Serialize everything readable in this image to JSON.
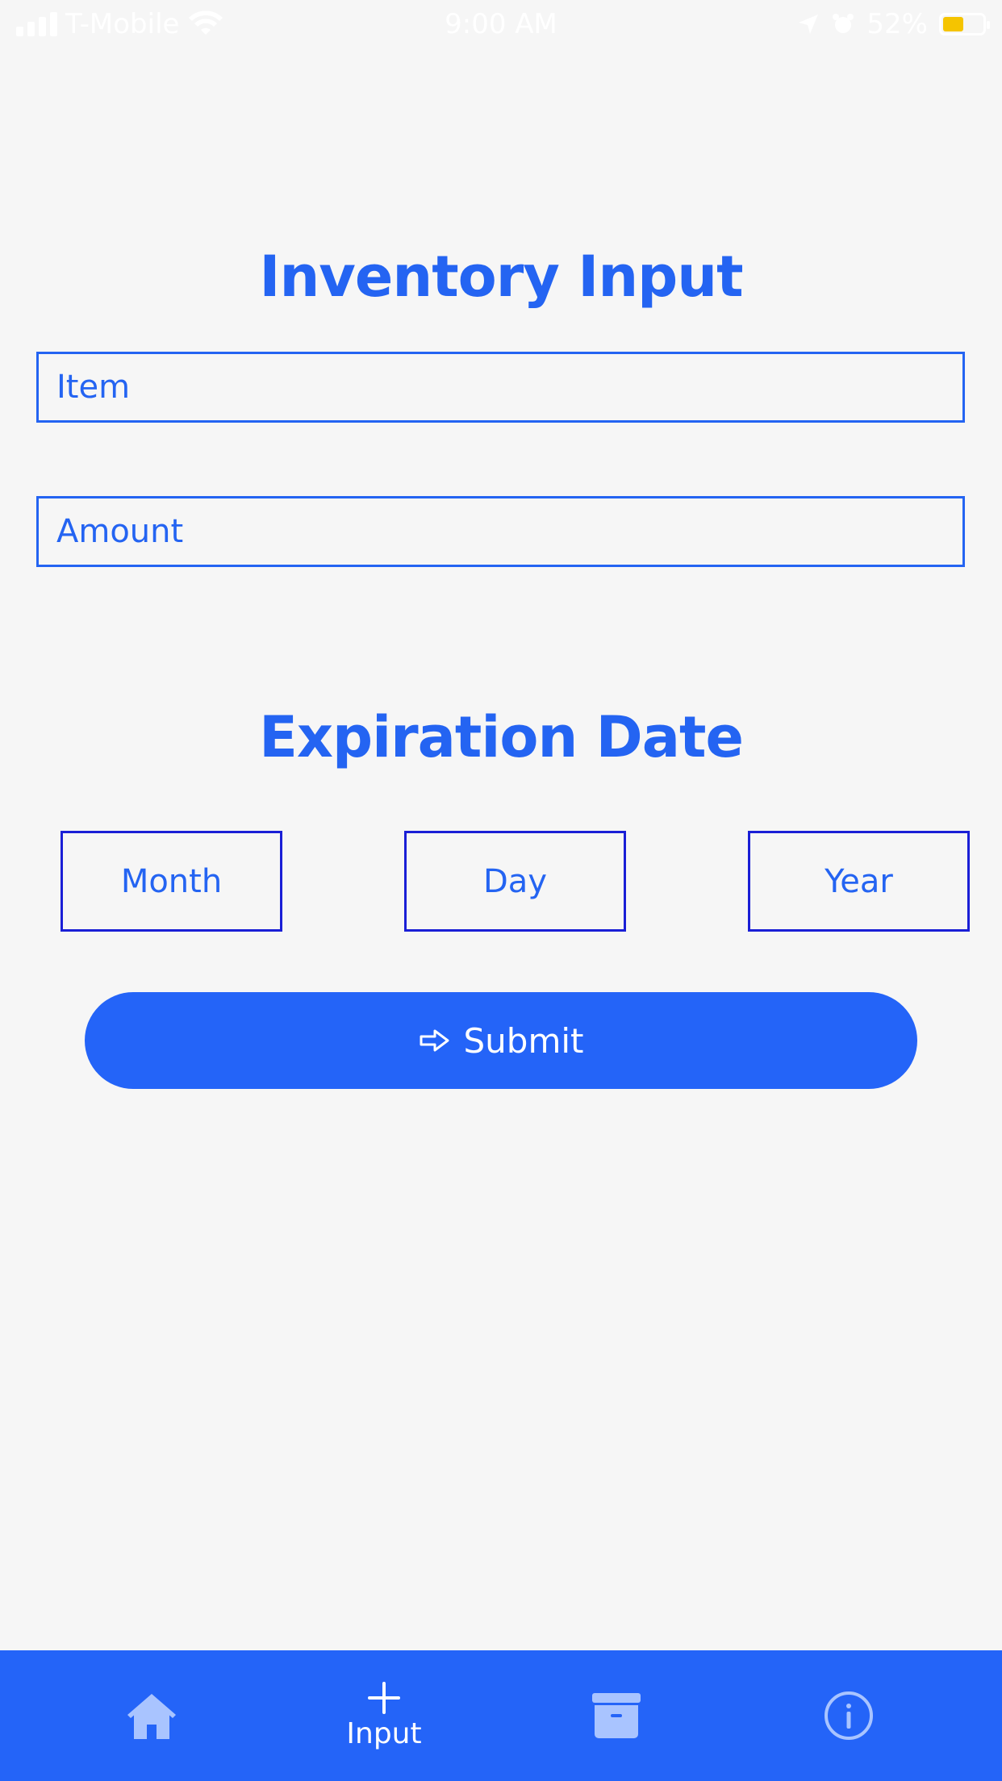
{
  "status_bar": {
    "carrier": "T-Mobile",
    "time": "9:00 AM",
    "battery": "52%",
    "battery_level": 0.52
  },
  "inventory": {
    "title": "Inventory Input",
    "item_placeholder": "Item",
    "amount_placeholder": "Amount"
  },
  "expiration": {
    "title": "Expiration Date",
    "month_label": "Month",
    "day_label": "Day",
    "year_label": "Year"
  },
  "submit": {
    "label": "Submit"
  },
  "tab_bar": {
    "input_label": "Input",
    "icons": [
      "home-icon",
      "plus-icon",
      "archive-icon",
      "info-icon"
    ]
  },
  "colors": {
    "accent": "#2464f2",
    "button": "#2464f8",
    "date_border": "#1a1fd6",
    "background": "#f6f6f6",
    "battery_fill": "#f5c400"
  }
}
